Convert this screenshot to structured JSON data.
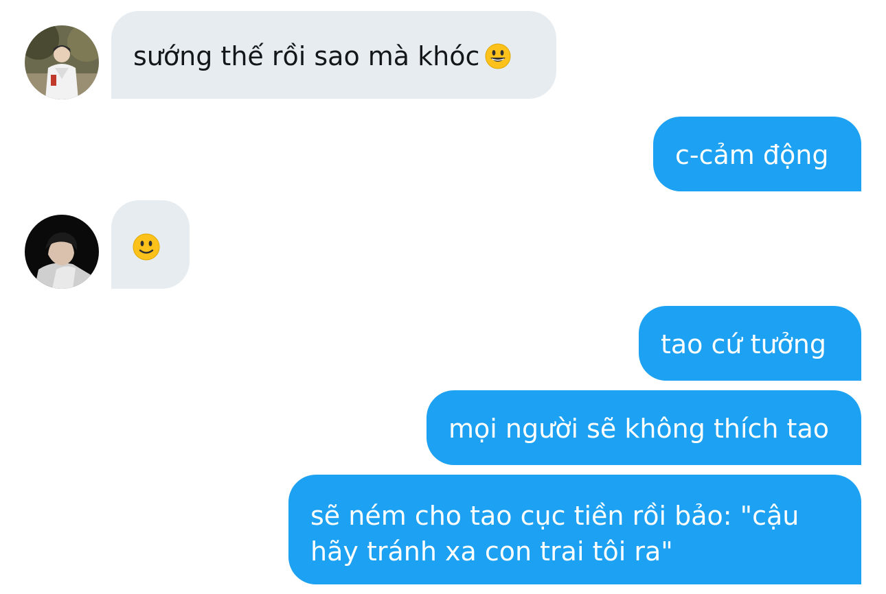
{
  "conversation": {
    "messages": [
      {
        "from": "other",
        "avatar": "avatar-boy-white-hoodie",
        "text": "sướng thế rồi sao mà khóc",
        "emoji": "grinning-face-emoji"
      },
      {
        "from": "me",
        "text": "c-cảm động"
      },
      {
        "from": "other",
        "avatar": "avatar-boy-dark-portrait",
        "emoji": "slightly-smiling-face-emoji"
      },
      {
        "from": "me",
        "text": "tao cứ tưởng"
      },
      {
        "from": "me",
        "text": "mọi người sẽ không thích tao"
      },
      {
        "from": "me",
        "text": "sẽ ném cho tao cục tiền rồi bảo: \"cậu hãy tránh xa con trai tôi ra\""
      }
    ]
  },
  "colors": {
    "incoming_bubble": "#e6ecf0",
    "outgoing_bubble": "#1da1f2",
    "incoming_text": "#14171a",
    "outgoing_text": "#ffffff"
  }
}
